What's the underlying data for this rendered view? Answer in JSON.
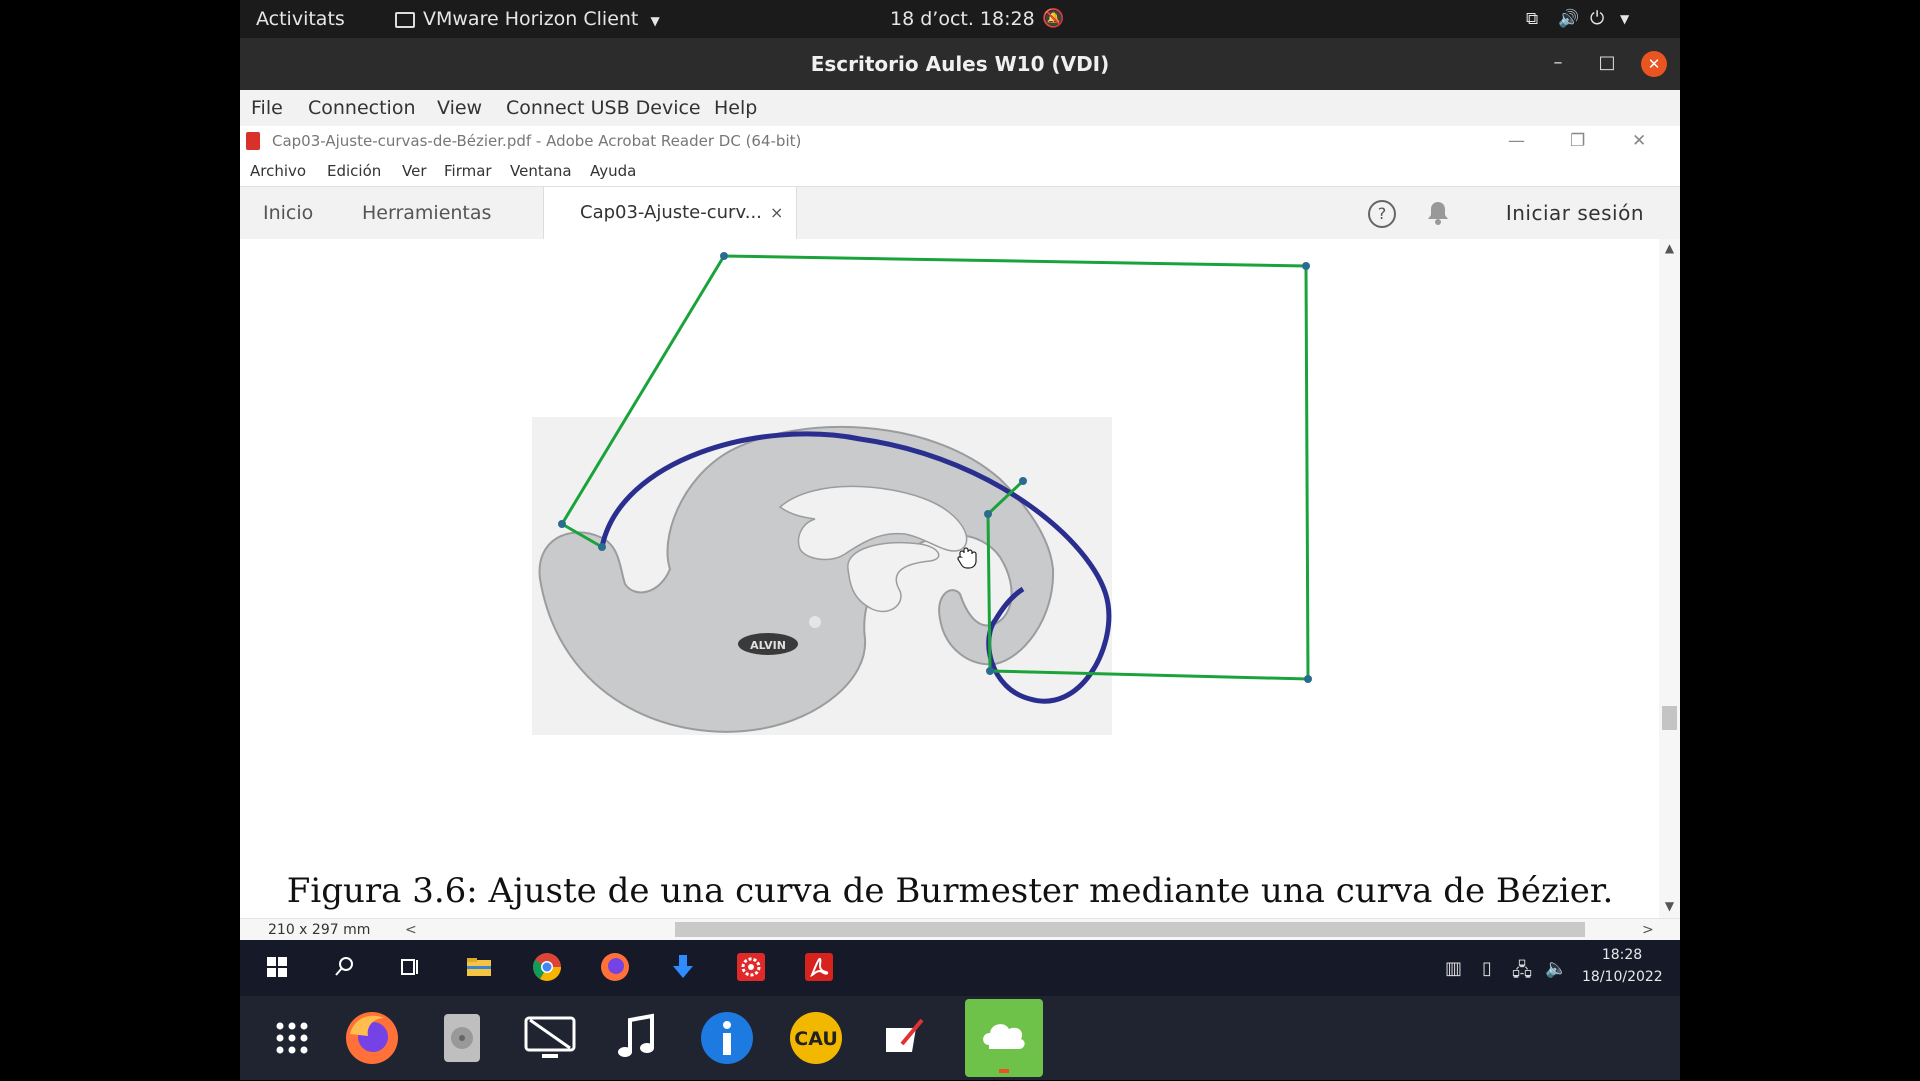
{
  "gnome_bar": {
    "activities": "Activitats",
    "app_menu": "VMware Horizon Client",
    "datetime": "18 d’oct.  18:28"
  },
  "vmware": {
    "window_title": "Escritorio Aules W10 (VDI)",
    "menu": [
      "File",
      "Connection",
      "View",
      "Connect USB Device",
      "Help"
    ]
  },
  "acrobat": {
    "window_title": "Cap03-Ajuste-curvas-de-Bézier.pdf - Adobe Acrobat Reader DC (64-bit)",
    "menu": [
      "Archivo",
      "Edición",
      "Ver",
      "Firmar",
      "Ventana",
      "Ayuda"
    ],
    "tabs": {
      "home": "Inicio",
      "tools": "Herramientas",
      "document": "Cap03-Ajuste-curv...",
      "close_glyph": "×"
    },
    "help_glyph": "?",
    "sign_in": "Iniciar sesión",
    "page_size": "210 x 297 mm",
    "figure_caption": "Figura 3.6: Ajuste de una curva de Burmester mediante una curva de Bézier.",
    "figure_logo_text": "ALVIN"
  },
  "colors": {
    "control_polygon": "#1aa33a",
    "bezier_curve": "#2a2f8f",
    "template_fill": "#c8cacc",
    "taskbar": "#161a28",
    "dock_bg": "#1f2430",
    "close_button": "#e95420"
  },
  "win_taskbar": {
    "time": "18:28",
    "date": "18/10/2022",
    "icons": [
      "windows-start-icon",
      "search-icon",
      "task-view-icon",
      "file-explorer-icon",
      "chrome-icon",
      "firefox-icon",
      "download-icon",
      "gear-app-icon",
      "acrobat-icon"
    ]
  },
  "dock": {
    "icons": [
      "apps-grid-icon",
      "firefox-icon",
      "disk-icon",
      "remote-desktop-icon",
      "music-icon",
      "info-icon",
      "cau-icon",
      "notes-icon",
      "cloud-sync-icon"
    ],
    "cau_label": "CAU"
  }
}
